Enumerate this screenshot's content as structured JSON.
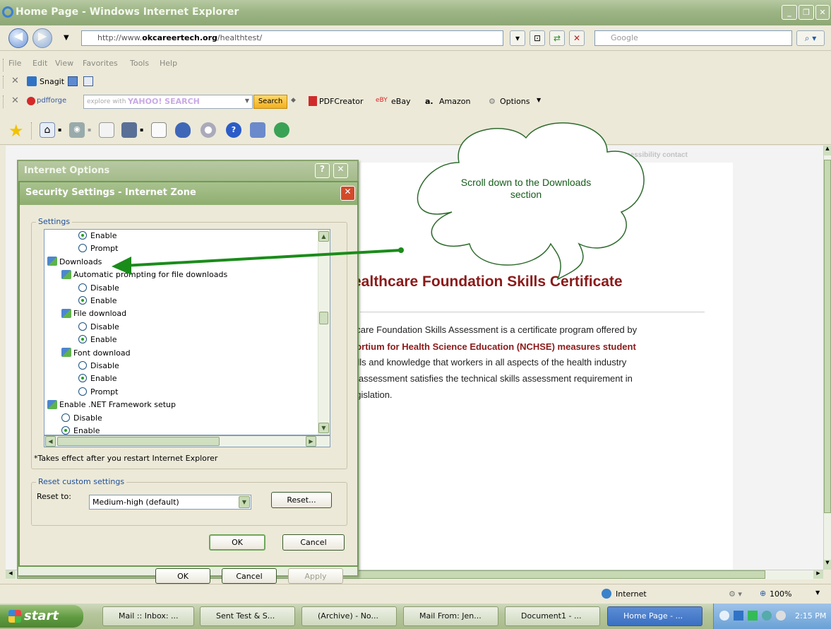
{
  "window": {
    "title": "Home Page - Windows Internet Explorer"
  },
  "address": {
    "url_prefix": "http://www.",
    "url_domain": "okcareertech.org",
    "url_path": "/healthtest/",
    "search_placeholder": "Google"
  },
  "menu": [
    "File",
    "Edit",
    "View",
    "Favorites",
    "Tools",
    "Help"
  ],
  "snagit": {
    "label": "Snagit"
  },
  "yahoo_bar": {
    "brand": "pdfforge",
    "search_placeholder": "explore with",
    "yahoo_logo": "YAHOO! SEARCH",
    "search_button": "Search",
    "pdfcreator": "PDFCreator",
    "ebay": "eBay",
    "amazon": "Amazon",
    "options": "Options"
  },
  "webpage": {
    "top_links": "accessibility  contact",
    "heading": "ealthcare Foundation Skills Certificate",
    "para_lines": [
      "hcare Foundation Skills Assessment is a certificate program offered by",
      "sortium for Health Science Education (NCHSE) measures student",
      "kills and knowledge that workers in all aspects of the health industry",
      "e assessment satisfies the technical skills assessment requirement in",
      "egislation."
    ]
  },
  "callout": {
    "text": "Scroll down to the Downloads section"
  },
  "internet_options": {
    "title": "Internet Options",
    "ok": "OK",
    "cancel": "Cancel",
    "apply": "Apply"
  },
  "security_dialog": {
    "title": "Security Settings - Internet Zone",
    "settings_label": "Settings",
    "tree": [
      {
        "type": "radio",
        "label": "Enable",
        "checked": true,
        "indent": 2
      },
      {
        "type": "radio",
        "label": "Prompt",
        "checked": false,
        "indent": 2
      },
      {
        "type": "group",
        "label": "Downloads",
        "indent": 0
      },
      {
        "type": "group",
        "label": "Automatic prompting for file downloads",
        "indent": 1
      },
      {
        "type": "radio",
        "label": "Disable",
        "checked": false,
        "indent": 2
      },
      {
        "type": "radio",
        "label": "Enable",
        "checked": true,
        "indent": 2
      },
      {
        "type": "group",
        "label": "File download",
        "indent": 1
      },
      {
        "type": "radio",
        "label": "Disable",
        "checked": false,
        "indent": 2
      },
      {
        "type": "radio",
        "label": "Enable",
        "checked": true,
        "indent": 2
      },
      {
        "type": "group",
        "label": "Font download",
        "indent": 1
      },
      {
        "type": "radio",
        "label": "Disable",
        "checked": false,
        "indent": 2
      },
      {
        "type": "radio",
        "label": "Enable",
        "checked": true,
        "indent": 2
      },
      {
        "type": "radio",
        "label": "Prompt",
        "checked": false,
        "indent": 2
      },
      {
        "type": "group",
        "label": "Enable .NET Framework setup",
        "indent": 0
      },
      {
        "type": "radio",
        "label": "Disable",
        "checked": false,
        "indent": 1
      },
      {
        "type": "radio",
        "label": "Enable",
        "checked": true,
        "indent": 1
      }
    ],
    "note": "*Takes effect after you restart Internet Explorer",
    "reset_group_label": "Reset custom settings",
    "reset_to_label": "Reset to:",
    "reset_select_value": "Medium-high (default)",
    "reset_button": "Reset...",
    "ok": "OK",
    "cancel": "Cancel"
  },
  "status": {
    "zone": "Internet",
    "zoom": "100%"
  },
  "taskbar": {
    "start": "start",
    "tasks": [
      "Mail :: Inbox: ...",
      "Sent Test & S...",
      "(Archive) - No...",
      "Mail From: Jen...",
      "Document1 - ...",
      "Home Page - ..."
    ],
    "clock": "2:15 PM"
  },
  "colors": {
    "xp_olive": "#8ea775",
    "arrow_green": "#1a8c1a",
    "heading_red": "#8b1a1a",
    "callout_text": "#155c1a"
  }
}
